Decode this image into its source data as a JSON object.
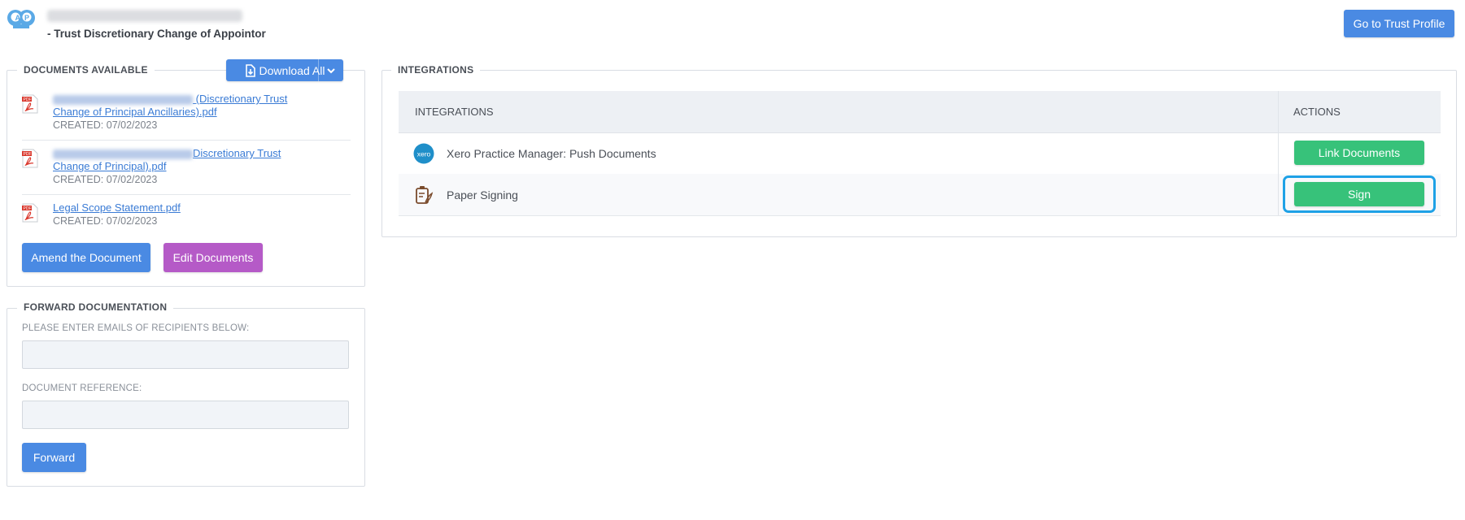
{
  "header": {
    "subtitle": "- Trust Discretionary Change of Appointor",
    "trust_profile_button": "Go to Trust Profile",
    "logo_icon": "trust-logo-icon"
  },
  "documents": {
    "legend": "DOCUMENTS AVAILABLE",
    "download_all_label": "Download All",
    "items": [
      {
        "link_visible": "(Discretionary Trust",
        "link_line2": "Change of Principal Ancillaries).pdf",
        "created": "CREATED: 07/02/2023"
      },
      {
        "link_visible": "Discretionary Trust",
        "link_line2": "Change of Principal).pdf",
        "created": "CREATED: 07/02/2023"
      },
      {
        "link_visible": "Legal Scope Statement.pdf",
        "link_line2": "",
        "created": "CREATED: 07/02/2023"
      }
    ],
    "amend_button": "Amend the Document",
    "edit_button": "Edit Documents"
  },
  "forward": {
    "legend": "FORWARD DOCUMENTATION",
    "emails_label": "PLEASE ENTER EMAILS OF RECIPIENTS BELOW:",
    "emails_value": "",
    "reference_label": "DOCUMENT REFERENCE:",
    "reference_value": "",
    "forward_button": "Forward"
  },
  "integrations": {
    "legend": "INTEGRATIONS",
    "col_integrations": "INTEGRATIONS",
    "col_actions": "ACTIONS",
    "rows": [
      {
        "name": "Xero Practice Manager: Push Documents",
        "action": "Link Documents",
        "icon": "xero-icon"
      },
      {
        "name": "Paper Signing",
        "action": "Sign",
        "icon": "paper-signing-icon"
      }
    ]
  },
  "colors": {
    "primary": "#4a8ae3",
    "purple": "#b55ac7",
    "green": "#37c27a",
    "focus": "#1ea1e6"
  }
}
